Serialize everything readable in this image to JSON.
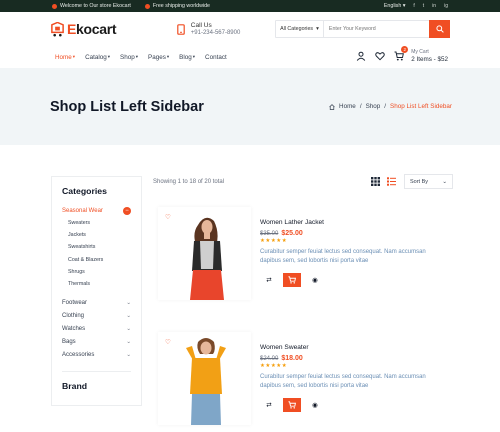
{
  "topbar": {
    "welcome": "Welcome to Our store Ekocart",
    "shipping": "Free shipping worldwide",
    "language": "English",
    "socials": [
      "f",
      "t",
      "in",
      "ig"
    ]
  },
  "header": {
    "logo_prefix": "E",
    "logo_rest": "kocart",
    "call_label": "Call Us",
    "phone": "+91-234-567-8900",
    "category_select": "All Categories",
    "search_placeholder": "Enter Your Keyword"
  },
  "nav": {
    "items": [
      {
        "label": "Home"
      },
      {
        "label": "Catalog"
      },
      {
        "label": "Shop"
      },
      {
        "label": "Pages"
      },
      {
        "label": "Blog"
      },
      {
        "label": "Contact"
      }
    ],
    "cart_count": "2",
    "cart_label": "My Cart",
    "cart_summary": "2 Items - $52"
  },
  "hero": {
    "title": "Shop List Left Sidebar",
    "crumbs": [
      "Home",
      "/",
      "Shop",
      "/",
      "Shop List Left Sidebar"
    ]
  },
  "sidebar": {
    "title": "Categories",
    "open_category": "Seasonal Wear",
    "subitems": [
      "Sweaters",
      "Jackets",
      "Sweatshirts",
      "Coat & Blazers",
      "Shrugs",
      "Thermals"
    ],
    "categories": [
      "Footwear",
      "Clothing",
      "Watches",
      "Bags",
      "Accessories"
    ],
    "brand_title": "Brand"
  },
  "toolbar": {
    "count_text": "Showing 1 to 18 of 20 total",
    "sort_label": "Sort By"
  },
  "products": [
    {
      "name": "Women Lather Jacket",
      "old_price": "$35.00",
      "new_price": "$25.00",
      "rating": 5,
      "description": "Curabitur semper feuiat lectus sed consequat. Nam accumsan dapibus sem, sed lobortis nisi porta vitae"
    },
    {
      "name": "Women Sweater",
      "old_price": "$24.00",
      "new_price": "$18.00",
      "rating": 5,
      "description": "Curabitur semper feuiat lectus sed consequat. Nam accumsan dapibus sem, sed lobortis nisi porta vitae"
    }
  ],
  "icons": {
    "stars": "★★★★★",
    "heart": "♡",
    "compare": "⇄",
    "view": "◉"
  },
  "colors": {
    "accent": "#f04e23",
    "topbar": "#182b22",
    "hero_bg": "#f1f5f7"
  }
}
